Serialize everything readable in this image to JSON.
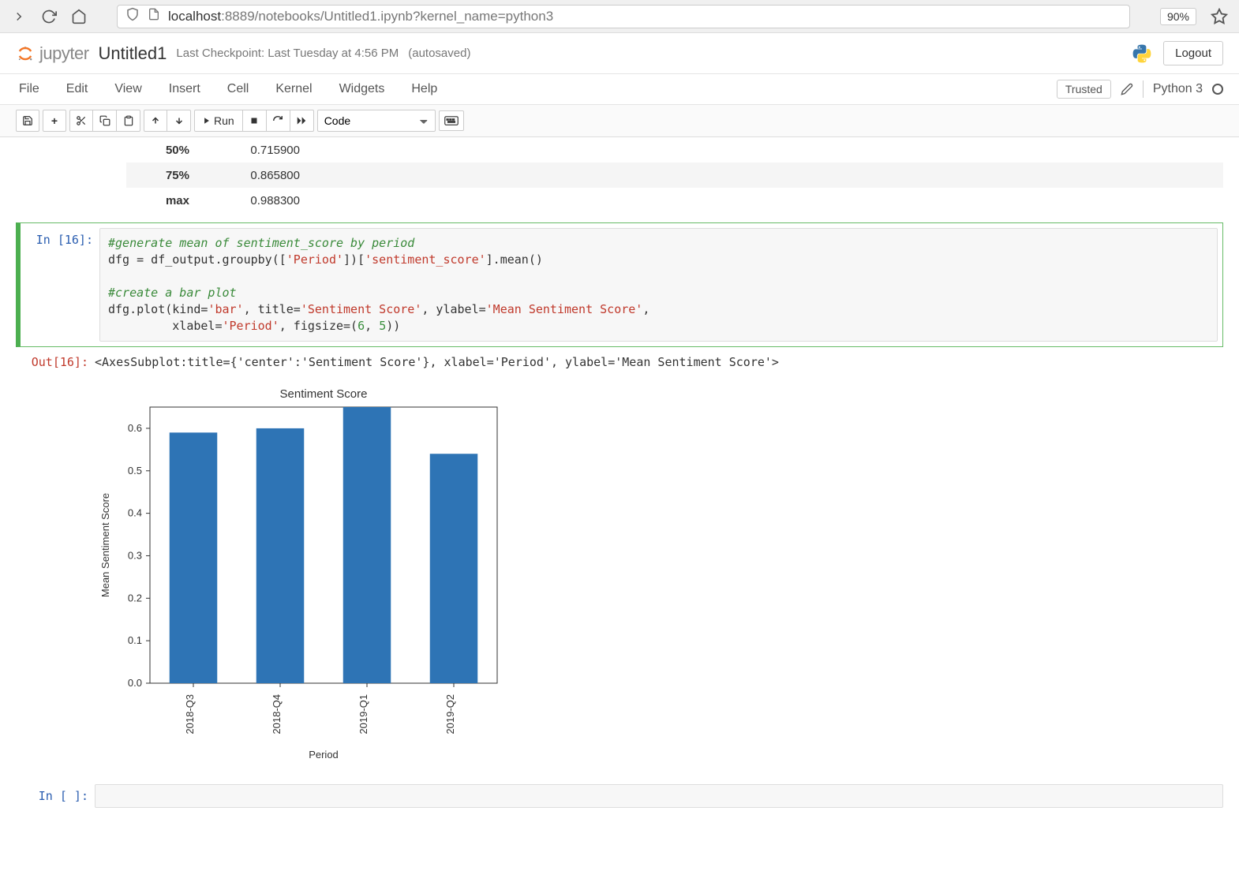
{
  "browser": {
    "url_host": "localhost",
    "url_rest": ":8889/notebooks/Untitled1.ipynb?kernel_name=python3",
    "zoom": "90%"
  },
  "header": {
    "logo_text": "jupyter",
    "notebook_name": "Untitled1",
    "checkpoint": "Last Checkpoint: Last Tuesday at 4:56 PM",
    "autosaved": "(autosaved)",
    "logout": "Logout"
  },
  "menubar": {
    "items": [
      "File",
      "Edit",
      "View",
      "Insert",
      "Cell",
      "Kernel",
      "Widgets",
      "Help"
    ],
    "trusted": "Trusted",
    "kernel": "Python 3"
  },
  "toolbar": {
    "run_label": "Run",
    "celltype": "Code"
  },
  "stats_fragment": [
    {
      "label": "50%",
      "value": "0.715900"
    },
    {
      "label": "75%",
      "value": "0.865800"
    },
    {
      "label": "max",
      "value": "0.988300"
    }
  ],
  "cell16": {
    "in_prompt": "In [16]:",
    "out_prompt": "Out[16]:",
    "code_comment1": "#generate mean of sentiment_score by period",
    "code_line2_a": "dfg = df_output.groupby([",
    "code_line2_s1": "'Period'",
    "code_line2_b": "])[",
    "code_line2_s2": "'sentiment_score'",
    "code_line2_c": "].mean()",
    "code_comment2": "#create a bar plot",
    "code_line4_a": "dfg.plot(kind=",
    "code_line4_s1": "'bar'",
    "code_line4_b": ", title=",
    "code_line4_s2": "'Sentiment Score'",
    "code_line4_c": ", ylabel=",
    "code_line4_s3": "'Mean Sentiment Score'",
    "code_line4_d": ",",
    "code_line5_a": "         xlabel=",
    "code_line5_s1": "'Period'",
    "code_line5_b": ", figsize=(",
    "code_line5_n1": "6",
    "code_line5_c": ", ",
    "code_line5_n2": "5",
    "code_line5_d": "))",
    "out_text": "<AxesSubplot:title={'center':'Sentiment Score'}, xlabel='Period', ylabel='Mean Sentiment Score'>"
  },
  "chart_data": {
    "type": "bar",
    "title": "Sentiment Score",
    "xlabel": "Period",
    "ylabel": "Mean Sentiment Score",
    "categories": [
      "2018-Q3",
      "2018-Q4",
      "2019-Q1",
      "2019-Q2"
    ],
    "values": [
      0.59,
      0.6,
      0.65,
      0.54
    ],
    "ylim": [
      0.0,
      0.65
    ],
    "yticks": [
      0.0,
      0.1,
      0.2,
      0.3,
      0.4,
      0.5,
      0.6
    ]
  },
  "empty_cell": {
    "prompt": "In [ ]:"
  }
}
